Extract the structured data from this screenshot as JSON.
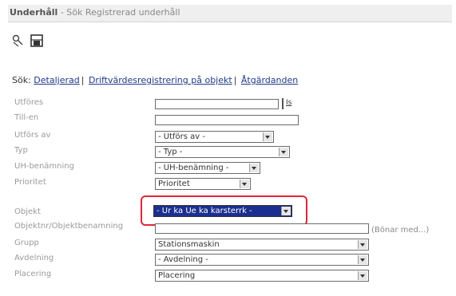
{
  "header": {
    "title_bold": "Underhåll",
    "title_rest": " - Sök Registrerad underhåll"
  },
  "toolbar": {
    "icons": [
      "search-tool-icon",
      "save-icon"
    ]
  },
  "nav": {
    "prefix": "Sök:",
    "links": [
      "Detaljerad",
      "Driftvärdesregistrering på objekt",
      "Åtgärdanden"
    ]
  },
  "form": {
    "utfores_label": "Utföres",
    "utfores_value": "",
    "date_button": "Is",
    "tillen_label": "Till-en",
    "tillen_value": "",
    "utforsav_label": "Utförs av",
    "utforsav_value": "- Utförs av -",
    "typ_label": "Typ",
    "typ_value": "- Typ -",
    "uhbenamning_label": "UH-benämning",
    "uhbenamning_value": "- UH-benämning -",
    "prioritet_label": "Prioritet",
    "prioritet_value": "Prioritet",
    "objekt_label": "Objekt",
    "objekt_value": "- Ur ka Ue ka karsterrk -",
    "objektnr_label": "Objektnr/Objektbenamning",
    "objektnr_value": "",
    "browse_link": "(Bönar med...)",
    "grupp_label": "Grupp",
    "grupp_value": "Stationsmaskin",
    "avdelning_label": "Avdelning",
    "avdelning_value": "- Avdelning -",
    "placering_label": "Placering",
    "placering_value": "Placering"
  },
  "colors": {
    "highlight": "#e0263a",
    "selected": "#1b2f8f",
    "link": "#1f3a8a"
  }
}
